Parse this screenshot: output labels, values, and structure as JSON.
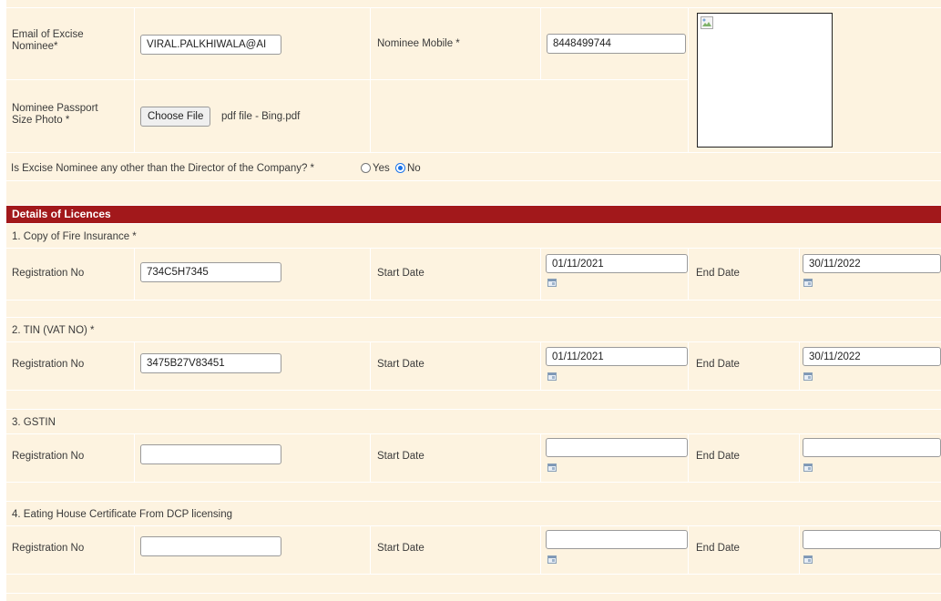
{
  "nominee": {
    "email_label": "Email of Excise Nominee*",
    "email_value": "VIRAL.PALKHIWALA@AI",
    "mobile_label": "Nominee Mobile *",
    "mobile_value": "8448499744",
    "photo_label": "Nominee Passport Size Photo *",
    "choose_file_label": "Choose File",
    "file_name": "pdf file - Bing.pdf",
    "other_than_director_question": "Is Excise Nominee any other than the Director of the Company? *",
    "option_yes": "Yes",
    "option_no": "No",
    "selected_option": "No"
  },
  "section_title": "Details of Licences",
  "licences": [
    {
      "title": "1. Copy of Fire Insurance  *",
      "reg_label": "Registration No",
      "reg_value": "734C5H7345",
      "start_label": "Start Date",
      "start_value": "01/11/2021",
      "end_label": "End Date",
      "end_value": "30/11/2022"
    },
    {
      "title": "2. TIN (VAT NO)  *",
      "reg_label": "Registration No",
      "reg_value": "3475B27V83451",
      "start_label": "Start Date",
      "start_value": "01/11/2021",
      "end_label": "End Date",
      "end_value": "30/11/2022"
    },
    {
      "title": "3. GSTIN",
      "reg_label": "Registration No",
      "reg_value": "",
      "start_label": "Start Date",
      "start_value": "",
      "end_label": "End Date",
      "end_value": ""
    },
    {
      "title": "4. Eating House Certificate From DCP licensing",
      "reg_label": "Registration No",
      "reg_value": "",
      "start_label": "Start Date",
      "start_value": "",
      "end_label": "End Date",
      "end_value": ""
    }
  ],
  "colors": {
    "row_background": "#fdf3e0",
    "section_header": "#a2181b",
    "radio_selected": "#1a73e8"
  },
  "icons": {
    "calendar": "calendar-icon",
    "broken_image": "broken-image-icon"
  }
}
